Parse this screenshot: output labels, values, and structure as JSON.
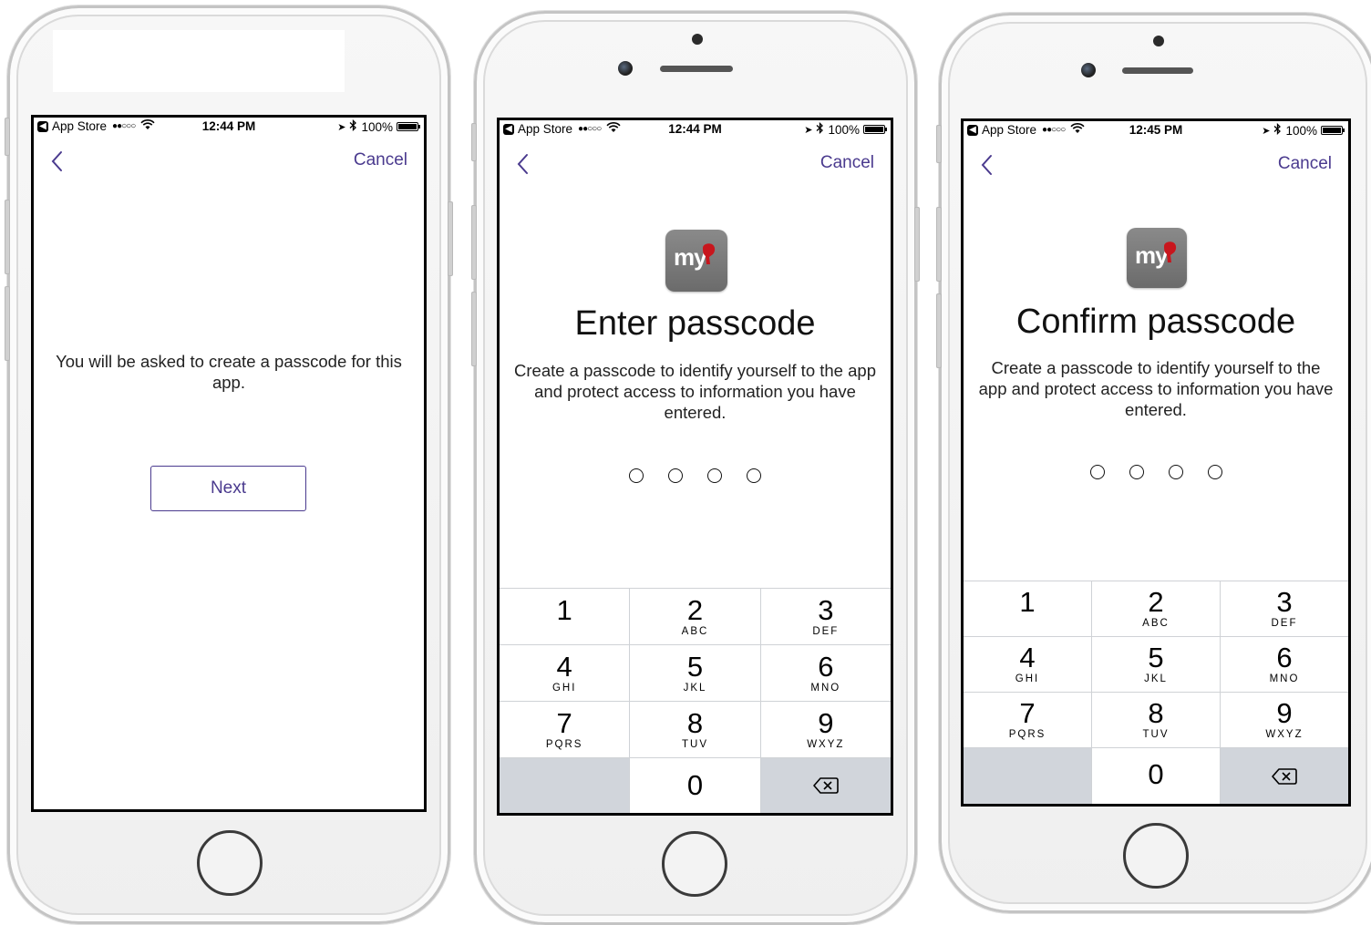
{
  "status_bar": {
    "app_back_label": "App Store",
    "signal": "●●○○○",
    "battery": "100%",
    "screens": [
      {
        "time": "12:44 PM"
      },
      {
        "time": "12:44 PM"
      },
      {
        "time": "12:45 PM"
      }
    ]
  },
  "nav": {
    "cancel_label": "Cancel"
  },
  "screen1": {
    "message": "You will be asked to create a passcode for this app.",
    "next_label": "Next"
  },
  "screen2": {
    "logo_text": "my",
    "title": "Enter passcode",
    "description": "Create a passcode to identify yourself to the app and protect access to information you have entered."
  },
  "screen3": {
    "logo_text": "my",
    "title": "Confirm passcode",
    "description": "Create a passcode to identify yourself to the app and protect access to information you have entered."
  },
  "keypad": {
    "keys": [
      {
        "num": "1",
        "letters": ""
      },
      {
        "num": "2",
        "letters": "ABC"
      },
      {
        "num": "3",
        "letters": "DEF"
      },
      {
        "num": "4",
        "letters": "GHI"
      },
      {
        "num": "5",
        "letters": "JKL"
      },
      {
        "num": "6",
        "letters": "MNO"
      },
      {
        "num": "7",
        "letters": "PQRS"
      },
      {
        "num": "8",
        "letters": "TUV"
      },
      {
        "num": "9",
        "letters": "WXYZ"
      },
      {
        "num": "0",
        "letters": ""
      }
    ]
  },
  "colors": {
    "accent": "#4a3a8e",
    "keypad_gray": "#d1d5db"
  },
  "icons": [
    "back-chevron-icon",
    "location-arrow-icon",
    "bluetooth-icon",
    "wifi-icon",
    "battery-icon",
    "backspace-icon",
    "app-logo-icon"
  ]
}
